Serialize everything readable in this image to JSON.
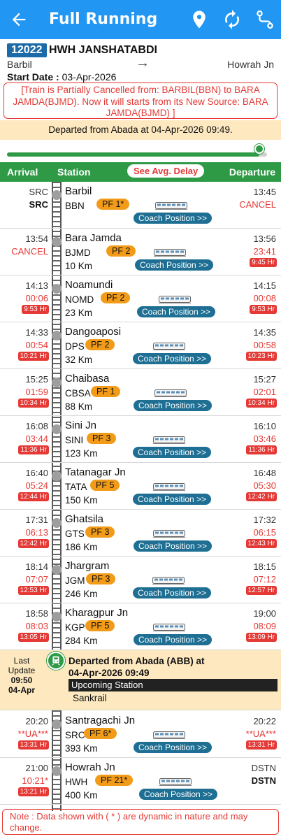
{
  "appbar": {
    "title": "Full Running",
    "icons": [
      "back-arrow-icon",
      "map-pin-icon",
      "refresh-icon",
      "route-icon"
    ],
    "color": "#2196f3"
  },
  "train": {
    "number": "12022",
    "name": "HWH JANSHATABDI",
    "from": "Barbil",
    "arrow": "→",
    "to": "Howrah Jn",
    "start_label": "Start Date :",
    "start_date": "03-Apr-2026",
    "cancel_notice": "[Train is Partially Cancelled from: BARBIL(BBN) to BARA JAMDA(BJMD). Now it will starts from its New Source: BARA JAMDA(BJMD) ]",
    "departed": "Departed from Abada at 04-Apr-2026 09:49.",
    "progress_fraction": 0.97
  },
  "columns": {
    "arrival": "Arrival",
    "station": "Station",
    "avg_delay": "See Avg. Delay",
    "departure": "Departure"
  },
  "coach_label": "Coach Position >>",
  "stations": [
    {
      "name": "Barbil",
      "code": "BBN",
      "pf": "PF 1*",
      "km": "",
      "arr": "SRC",
      "arr_delay": "SRC",
      "arr_hr": "",
      "dep": "13:45",
      "dep_delay": "CANCEL",
      "dep_hr": ""
    },
    {
      "name": "Bara Jamda",
      "code": "BJMD",
      "pf": "PF 2",
      "km": "10 Km",
      "arr": "13:54",
      "arr_delay": "CANCEL",
      "arr_hr": "",
      "dep": "13:56",
      "dep_delay": "23:41",
      "dep_hr": "9:45 Hr"
    },
    {
      "name": "Noamundi",
      "code": "NOMD",
      "pf": "PF 2",
      "km": "23 Km",
      "arr": "14:13",
      "arr_delay": "00:06",
      "arr_hr": "9:53 Hr",
      "dep": "14:15",
      "dep_delay": "00:08",
      "dep_hr": "9:53 Hr"
    },
    {
      "name": "Dangoaposi",
      "code": "DPS",
      "pf": "PF 2",
      "km": "32 Km",
      "arr": "14:33",
      "arr_delay": "00:54",
      "arr_hr": "10:21 Hr",
      "dep": "14:35",
      "dep_delay": "00:58",
      "dep_hr": "10:23 Hr"
    },
    {
      "name": "Chaibasa",
      "code": "CBSA",
      "pf": "PF 1",
      "km": "88 Km",
      "arr": "15:25",
      "arr_delay": "01:59",
      "arr_hr": "10:34 Hr",
      "dep": "15:27",
      "dep_delay": "02:01",
      "dep_hr": "10:34 Hr"
    },
    {
      "name": "Sini Jn",
      "code": "SINI",
      "pf": "PF 3",
      "km": "123 Km",
      "arr": "16:08",
      "arr_delay": "03:44",
      "arr_hr": "11:36 Hr",
      "dep": "16:10",
      "dep_delay": "03:46",
      "dep_hr": "11:36 Hr"
    },
    {
      "name": "Tatanagar Jn",
      "code": "TATA",
      "pf": "PF 5",
      "km": "150 Km",
      "arr": "16:40",
      "arr_delay": "05:24",
      "arr_hr": "12:44 Hr",
      "dep": "16:48",
      "dep_delay": "05:30",
      "dep_hr": "12:42 Hr"
    },
    {
      "name": "Ghatsila",
      "code": "GTS",
      "pf": "PF 3",
      "km": "186 Km",
      "arr": "17:31",
      "arr_delay": "06:13",
      "arr_hr": "12:42 Hr",
      "dep": "17:32",
      "dep_delay": "06:15",
      "dep_hr": "12:43 Hr"
    },
    {
      "name": "Jhargram",
      "code": "JGM",
      "pf": "PF 3",
      "km": "246 Km",
      "arr": "18:14",
      "arr_delay": "07:07",
      "arr_hr": "12:53 Hr",
      "dep": "18:15",
      "dep_delay": "07:12",
      "dep_hr": "12:57 Hr"
    },
    {
      "name": "Kharagpur Jn",
      "code": "KGP",
      "pf": "PF 5",
      "km": "284 Km",
      "arr": "18:58",
      "arr_delay": "08:03",
      "arr_hr": "13:05 Hr",
      "dep": "19:00",
      "dep_delay": "08:09",
      "dep_hr": "13:09 Hr"
    },
    {
      "name": "Santragachi Jn",
      "code": "SRC",
      "pf": "PF 6*",
      "km": "393 Km",
      "arr": "20:20",
      "arr_delay": "**UA***",
      "arr_hr": "13:31 Hr",
      "dep": "20:22",
      "dep_delay": "**UA***",
      "dep_hr": "13:31 Hr"
    },
    {
      "name": "Howrah Jn",
      "code": "HWH",
      "pf": "PF 21*",
      "km": "400 Km",
      "arr": "21:00",
      "arr_delay": "10:21*",
      "arr_hr": "13:21 Hr",
      "dep": "DSTN",
      "dep_delay": "DSTN",
      "dep_hr": ""
    }
  ],
  "live": {
    "last": "Last",
    "update": "Update",
    "time": "09:50",
    "date": "04-Apr",
    "line1": "Departed from Abada (ABB) at",
    "line2": "04-Apr-2026 09:49",
    "upcoming": "Upcoming Station",
    "next": "Sankrail"
  },
  "note": "Note : Data shown with ( * ) are dynamic in nature and may change."
}
